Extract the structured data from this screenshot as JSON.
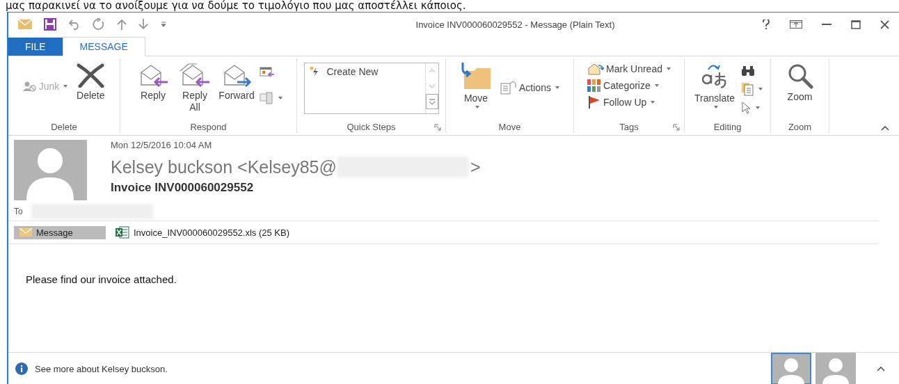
{
  "caption": "μας παρακινεί να το ανοίξουμε για να δούμε το τιμολόγιο που μας αποστέλλει κάποιος.",
  "window": {
    "title": "Invoice INV000060029552 - Message (Plain Text)"
  },
  "tabs": [
    {
      "label": "FILE",
      "kind": "file",
      "selected": false
    },
    {
      "label": "MESSAGE",
      "kind": "normal",
      "selected": true
    }
  ],
  "ribbon": {
    "groups": [
      {
        "kind": "delete",
        "label": "Delete",
        "launcher": false,
        "commands": [
          {
            "label": "Junk",
            "disabled": true
          },
          {
            "label": "Delete",
            "disabled": false
          }
        ]
      },
      {
        "kind": "respond",
        "label": "Respond",
        "launcher": false,
        "commands": [
          {
            "label": "Reply",
            "disabled": false
          },
          {
            "label": "Reply All",
            "disabled": false
          },
          {
            "label": "Forward",
            "disabled": false
          }
        ]
      },
      {
        "kind": "quicksteps",
        "label": "Quick Steps",
        "launcher": true,
        "commands": [
          {
            "label": "Create New",
            "disabled": false
          }
        ]
      },
      {
        "kind": "move",
        "label": "Move",
        "launcher": false,
        "commands": [
          {
            "label": "Move",
            "disabled": false
          },
          {
            "label": "Actions",
            "disabled": false
          }
        ]
      },
      {
        "kind": "tags",
        "label": "Tags",
        "launcher": true,
        "commands": [
          {
            "label": "Mark Unread",
            "disabled": false
          },
          {
            "label": "Categorize",
            "disabled": false
          },
          {
            "label": "Follow Up",
            "disabled": false
          }
        ]
      },
      {
        "kind": "editing",
        "label": "Editing",
        "launcher": false,
        "commands": [
          {
            "label": "Translate",
            "disabled": false
          }
        ]
      },
      {
        "kind": "zoom",
        "label": "Zoom",
        "launcher": false,
        "commands": [
          {
            "label": "Zoom",
            "disabled": false
          }
        ]
      }
    ]
  },
  "message": {
    "date": "Mon 12/5/2016 10:04 AM",
    "sender": "Kelsey buckson <Kelsey85@",
    "sender_end": ">",
    "subject": "Invoice INV000060029552",
    "to_label": "To",
    "attachments": [
      {
        "label": "Message",
        "kind": "message",
        "selected": true
      },
      {
        "label": "Invoice_INV000060029552.xls (25 KB)",
        "kind": "excel",
        "selected": false
      }
    ],
    "body": "Please find our invoice attached."
  },
  "footer": {
    "text": "See more about Kelsey buckson.",
    "people": [
      {
        "selected": true
      },
      {
        "selected": false
      }
    ]
  }
}
